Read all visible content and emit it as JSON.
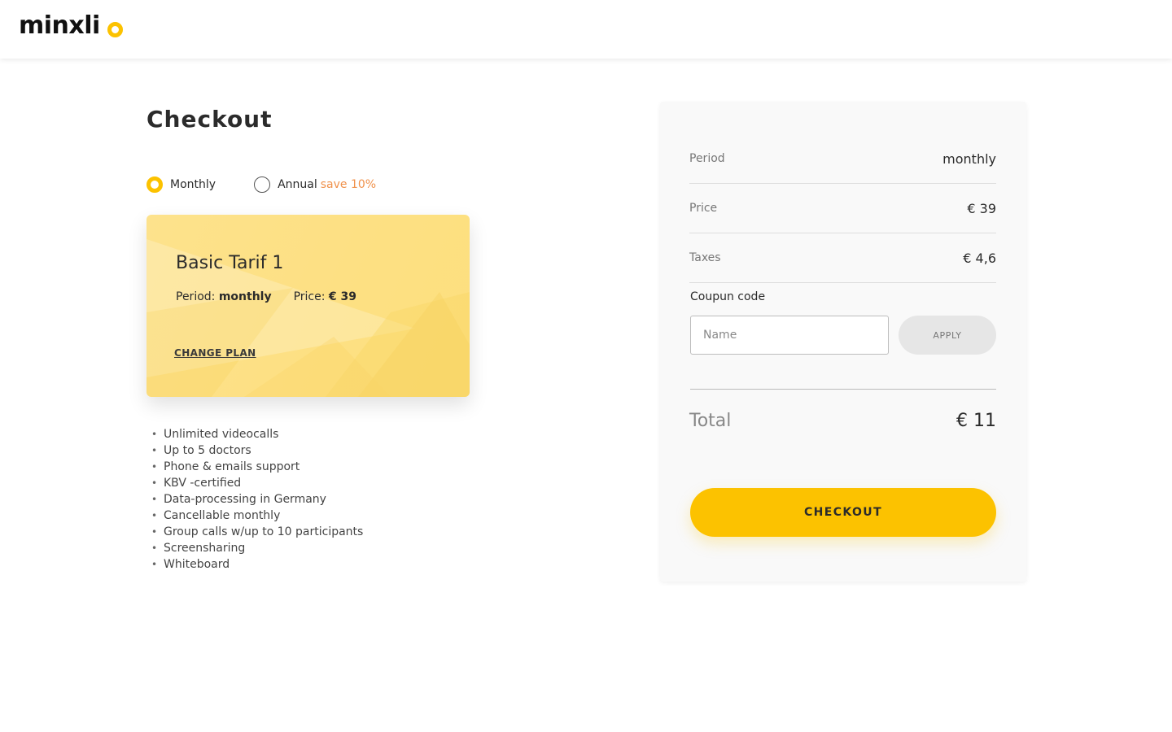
{
  "brand": {
    "logo_text": "minxli",
    "accent_color": "#fcc200"
  },
  "page": {
    "title": "Checkout"
  },
  "billing": {
    "options": [
      {
        "label": "Monthly",
        "checked": true
      },
      {
        "label": "Annual",
        "checked": false
      }
    ],
    "annual_note": "save 10%",
    "note_color": "#f0914b"
  },
  "plan": {
    "name": "Basic Tarif 1",
    "period_label": "Period:",
    "period_value": "monthly",
    "price_label": "Price:",
    "price_value": "€ 39",
    "change_label": "CHANGE PLAN"
  },
  "features": [
    "Unlimited videocalls",
    "Up to 5 doctors",
    "Phone &  emails support",
    "KBV -certified",
    "Data-processing in Germany",
    "Cancellable monthly",
    "Group calls w/up to 10 participants",
    "Screensharing",
    "Whiteboard"
  ],
  "summary": {
    "rows": [
      {
        "label": "Period",
        "value": "monthly"
      },
      {
        "label": "Price",
        "value": "€ 39"
      },
      {
        "label": "Taxes",
        "value": "€ 4,6"
      }
    ],
    "coupon_label": "Coupun code",
    "coupon_placeholder": "Name",
    "apply_label": "APPLY",
    "total_label": "Total",
    "total_value": "€ 11",
    "checkout_label": "CHECKOUT"
  }
}
